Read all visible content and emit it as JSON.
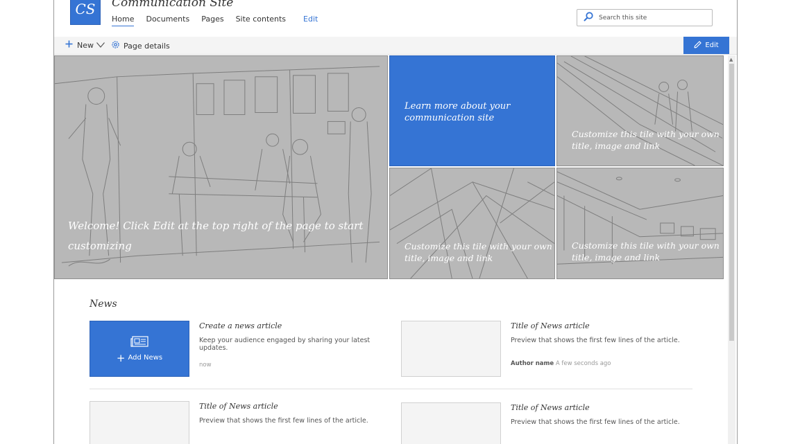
{
  "site": {
    "logo_text": "CS",
    "title": "Communication Site"
  },
  "nav": {
    "items": [
      "Home",
      "Documents",
      "Pages",
      "Site contents"
    ],
    "edit_link": "Edit"
  },
  "search": {
    "placeholder": "Search this site"
  },
  "commandbar": {
    "new_label": "New",
    "page_details_label": "Page details",
    "edit_button_label": "Edit"
  },
  "hero": {
    "main_caption": "Welcome! Click Edit at the top right of the page to start customizing",
    "blue_caption": "Learn more about your communication site",
    "tile_r1_caption": "Customize this tile with your own title, image and link",
    "tile_b1_caption": "Customize this tile with your own title, image and link",
    "tile_b2_caption": "Customize this tile with your own title, image and link"
  },
  "news": {
    "heading": "News",
    "add_news_label": "Add News",
    "items": [
      {
        "title": "Create a news article",
        "preview": "Keep your audience engaged by sharing your latest updates.",
        "time": "now"
      },
      {
        "title": "Title of News article",
        "preview": "Preview that shows the first few lines of the article.",
        "author": "Author name",
        "time": "A few seconds ago"
      },
      {
        "title": "Title of News article",
        "preview": "Preview that shows the first few lines of the article."
      },
      {
        "title": "Title of News article",
        "preview": "Preview that shows the first few lines of the article."
      }
    ]
  },
  "colors": {
    "accent": "#3574d4",
    "tile_gray": "#b8b8b8",
    "command_bar": "#f4f4f4"
  }
}
